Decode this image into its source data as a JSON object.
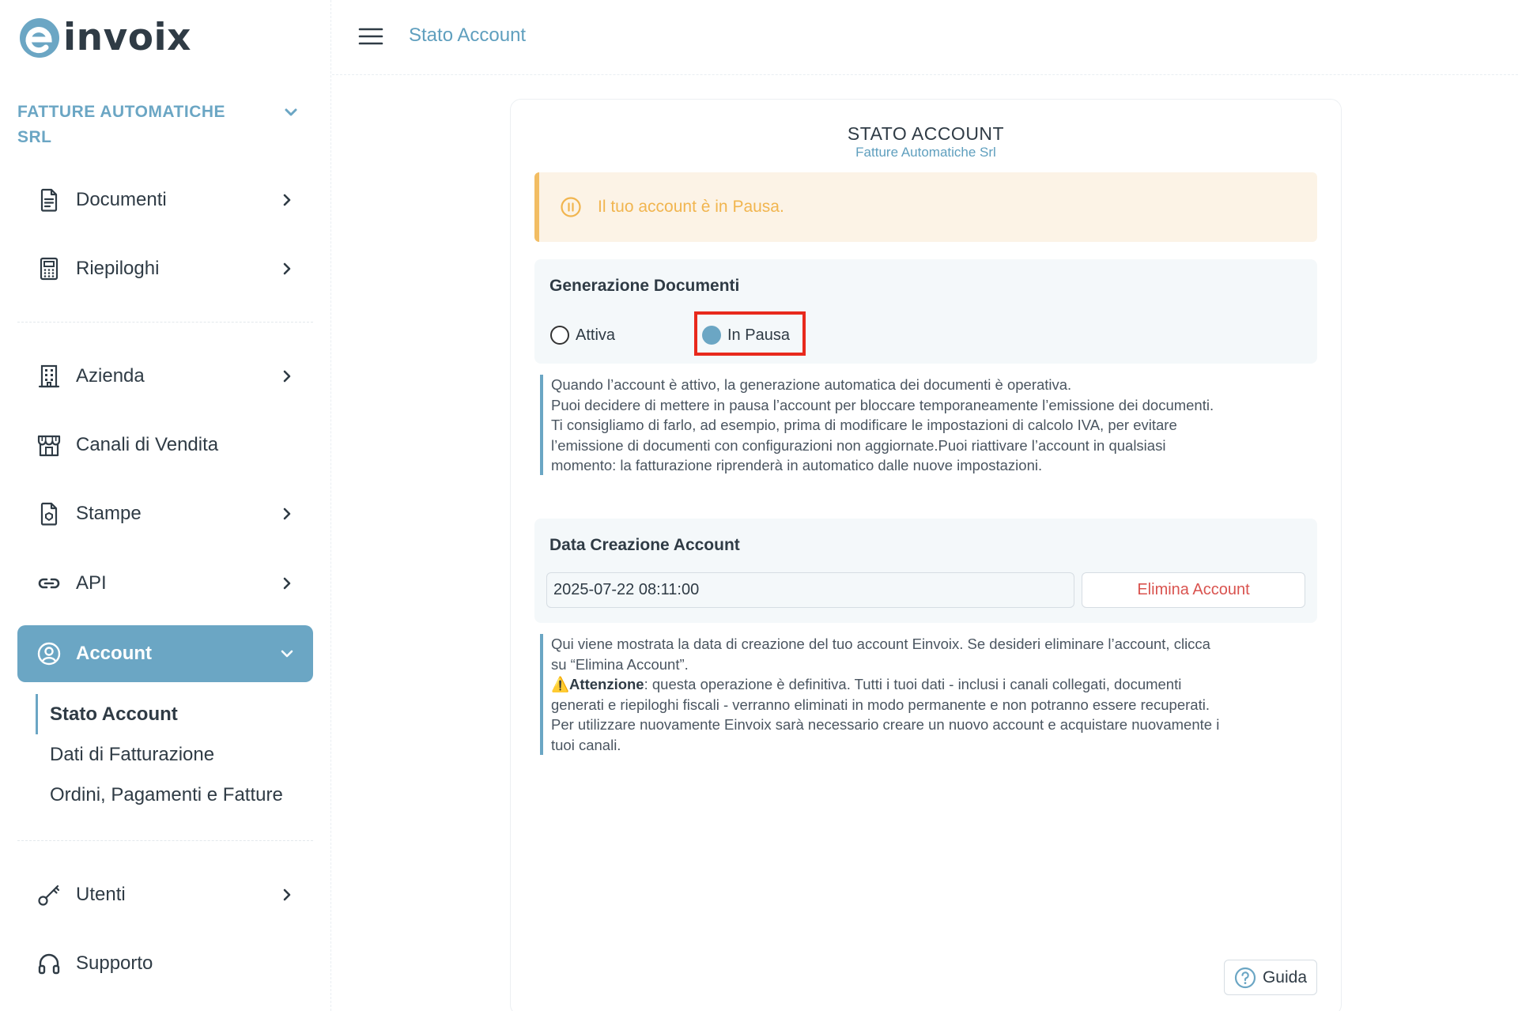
{
  "brand": {
    "name": "invoix",
    "accent": "#6ba6c4"
  },
  "sidebar": {
    "company": "FATTURE AUTOMATICHE SRL",
    "items": [
      {
        "label": "Documenti",
        "icon": "document-icon"
      },
      {
        "label": "Riepiloghi",
        "icon": "calculator-icon"
      },
      {
        "label": "Azienda",
        "icon": "building-icon"
      },
      {
        "label": "Canali di Vendita",
        "icon": "store-icon"
      },
      {
        "label": "Stampe",
        "icon": "print-document-icon"
      },
      {
        "label": "API",
        "icon": "link-icon"
      },
      {
        "label": "Account",
        "icon": "user-circle-icon"
      },
      {
        "label": "Utenti",
        "icon": "key-icon"
      },
      {
        "label": "Supporto",
        "icon": "headphones-icon"
      }
    ],
    "account_sub": [
      {
        "label": "Stato Account"
      },
      {
        "label": "Dati di Fatturazione"
      },
      {
        "label": "Ordini, Pagamenti e Fatture"
      }
    ]
  },
  "topbar": {
    "title": "Stato Account"
  },
  "card": {
    "title": "STATO ACCOUNT",
    "subtitle": "Fatture Automatiche Srl",
    "alert": {
      "text": "Il tuo account è in Pausa.",
      "color": "#f1b54f"
    },
    "generation": {
      "title": "Generazione Documenti",
      "options": [
        {
          "label": "Attiva",
          "selected": false
        },
        {
          "label": "In Pausa",
          "selected": true
        }
      ]
    },
    "generation_note": [
      "Quando l’account è attivo, la generazione automatica dei documenti è operativa.",
      "Puoi decidere di mettere in pausa l’account per bloccare temporaneamente l’emissione dei documenti.",
      "Ti consigliamo di farlo, ad esempio, prima di modificare le impostazioni di calcolo IVA, per evitare",
      "l’emissione di documenti con configurazioni non aggiornate.Puoi riattivare l’account in qualsiasi",
      "momento: la fatturazione riprenderà in automatico dalle nuove impostazioni."
    ],
    "creation": {
      "title": "Data Creazione Account",
      "date_value": "2025-07-22 08:11:00",
      "delete_label": "Elimina Account"
    },
    "creation_note": {
      "line1": "Qui viene mostrata la data di creazione del tuo account Einvoix. Se desideri eliminare l’account, clicca",
      "line2": "su “Elimina Account”.",
      "warning_icon": "⚠️",
      "warning_label": "Attenzione",
      "line3_rest": ": questa operazione è definitiva. Tutti i tuoi dati - inclusi i canali collegati, documenti",
      "line4": "generati e riepiloghi fiscali - verranno eliminati in modo permanente e non potranno essere recuperati.",
      "line5": "Per utilizzare nuovamente Einvoix sarà necessario creare un nuovo account e acquistare nuovamente i",
      "line6": "tuoi canali."
    },
    "guide_label": "Guida"
  }
}
